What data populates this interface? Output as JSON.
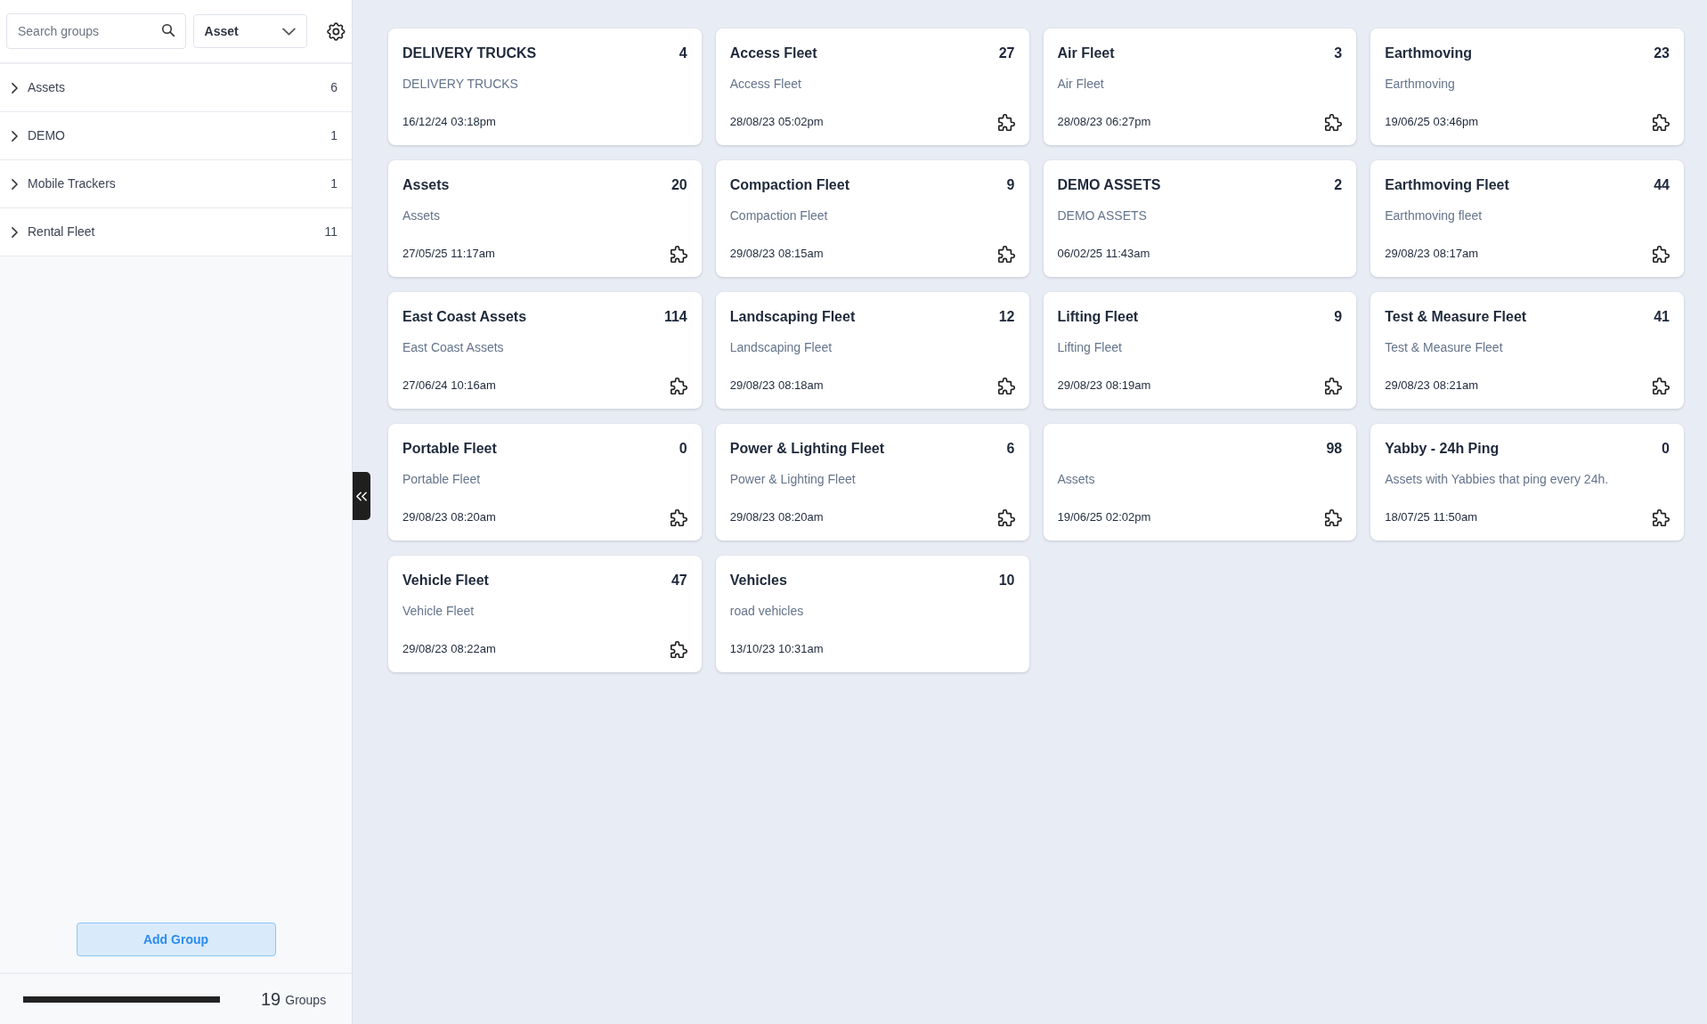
{
  "sidebar": {
    "search": {
      "placeholder": "Search groups"
    },
    "type_select": {
      "value": "Asset"
    },
    "groups": [
      {
        "label": "Assets",
        "count": "6",
        "expanded": false
      },
      {
        "label": "DEMO",
        "count": "1",
        "expanded": false
      },
      {
        "label": "Mobile Trackers",
        "count": "1",
        "expanded": false
      },
      {
        "label": "Rental Fleet",
        "count": "11",
        "expanded": false
      }
    ],
    "add_button": "Add Group",
    "footer": {
      "progress": {
        "level": 1
      },
      "count": "19",
      "unit": "Groups"
    }
  },
  "cards": [
    {
      "title": "DELIVERY TRUCKS",
      "count": "4",
      "description": "DELIVERY TRUCKS",
      "updated": "16/12/24 03:18pm",
      "puzzle_icon": false
    },
    {
      "title": "Access Fleet",
      "count": "27",
      "description": "Access Fleet",
      "updated": "28/08/23 05:02pm",
      "puzzle_icon": true
    },
    {
      "title": "Air Fleet",
      "count": "3",
      "description": "Air Fleet",
      "updated": "28/08/23 06:27pm",
      "puzzle_icon": true
    },
    {
      "title": "Earthmoving",
      "count": "23",
      "description": "Earthmoving",
      "updated": "19/06/25 03:46pm",
      "puzzle_icon": true
    },
    {
      "title": "Assets",
      "count": "20",
      "description": "Assets",
      "updated": "27/05/25 11:17am",
      "puzzle_icon": true
    },
    {
      "title": "Compaction Fleet",
      "count": "9",
      "description": "Compaction Fleet",
      "updated": "29/08/23 08:15am",
      "puzzle_icon": true
    },
    {
      "title": "DEMO ASSETS",
      "count": "2",
      "description": "DEMO ASSETS",
      "updated": "06/02/25 11:43am",
      "puzzle_icon": false
    },
    {
      "title": "Earthmoving Fleet",
      "count": "44",
      "description": "Earthmoving fleet",
      "updated": "29/08/23 08:17am",
      "puzzle_icon": true
    },
    {
      "title": "East Coast Assets",
      "count": "114",
      "description": "East Coast Assets",
      "updated": "27/06/24 10:16am",
      "puzzle_icon": true
    },
    {
      "title": "Landscaping Fleet",
      "count": "12",
      "description": "Landscaping Fleet",
      "updated": "29/08/23 08:18am",
      "puzzle_icon": true
    },
    {
      "title": "Lifting Fleet",
      "count": "9",
      "description": "Lifting Fleet",
      "updated": "29/08/23 08:19am",
      "puzzle_icon": true
    },
    {
      "title": "Test & Measure Fleet",
      "count": "41",
      "description": "Test & Measure Fleet",
      "updated": "29/08/23 08:21am",
      "puzzle_icon": true
    },
    {
      "title": "Portable Fleet",
      "count": "0",
      "description": "Portable Fleet",
      "updated": "29/08/23 08:20am",
      "puzzle_icon": true
    },
    {
      "title": "Power & Lighting Fleet",
      "count": "6",
      "description": "Power & Lighting Fleet",
      "updated": "29/08/23 08:20am",
      "puzzle_icon": true
    },
    {
      "count": "98",
      "description": "Assets",
      "updated": "19/06/25 02:02pm",
      "puzzle_icon": true
    },
    {
      "title": "Yabby - 24h Ping",
      "count": "0",
      "description": "Assets with Yabbies that ping every 24h.",
      "updated": "18/07/25 11:50am",
      "puzzle_icon": true
    },
    {
      "title": "Vehicle Fleet",
      "count": "47",
      "description": "Vehicle Fleet",
      "updated": "29/08/23 08:22am",
      "puzzle_icon": true
    },
    {
      "title": "Vehicles",
      "count": "10",
      "description": "road vehicles",
      "updated": "13/10/23 10:31am",
      "puzzle_icon": false
    }
  ]
}
